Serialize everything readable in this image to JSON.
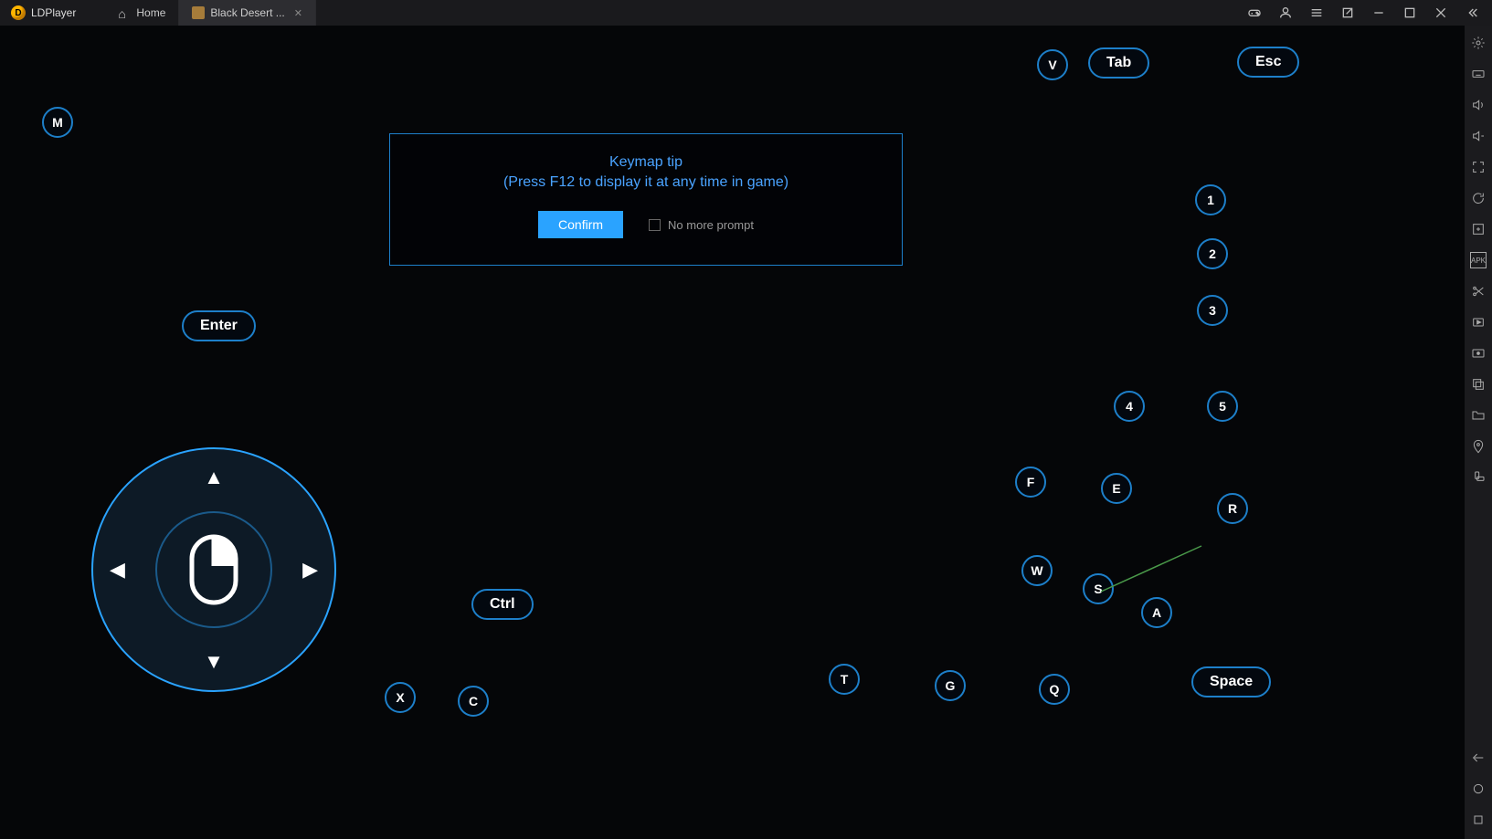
{
  "app": {
    "name": "LDPlayer"
  },
  "tabs": [
    {
      "label": "Home",
      "icon": "home-icon",
      "active": false
    },
    {
      "label": "Black Desert ...",
      "icon": "game-icon",
      "active": true
    }
  ],
  "titlebar_icons": [
    "gamepad",
    "user",
    "menu",
    "popout",
    "minimize",
    "maximize",
    "close",
    "collapse"
  ],
  "right_toolbar": [
    "settings-gear",
    "keyboard",
    "volume-up",
    "volume-down",
    "fullscreen",
    "refresh",
    "add-window",
    "apk",
    "scissors",
    "record",
    "screenshot",
    "copy",
    "folder",
    "location-pin",
    "rotate"
  ],
  "right_toolbar_bottom": [
    "back-arrow",
    "home-triangle",
    "recent-square"
  ],
  "popup": {
    "title": "Keymap tip",
    "subtitle": "(Press F12 to display it at any time in game)",
    "confirm": "Confirm",
    "no_more": "No more prompt"
  },
  "keys": {
    "M": "M",
    "Enter": "Enter",
    "V": "V",
    "Tab": "Tab",
    "Esc": "Esc",
    "1": "1",
    "2": "2",
    "3": "3",
    "4": "4",
    "5": "5",
    "F": "F",
    "E": "E",
    "R": "R",
    "W": "W",
    "S": "S",
    "A": "A",
    "T": "T",
    "G": "G",
    "Q": "Q",
    "X": "X",
    "C": "C",
    "Ctrl": "Ctrl",
    "Space": "Space"
  }
}
